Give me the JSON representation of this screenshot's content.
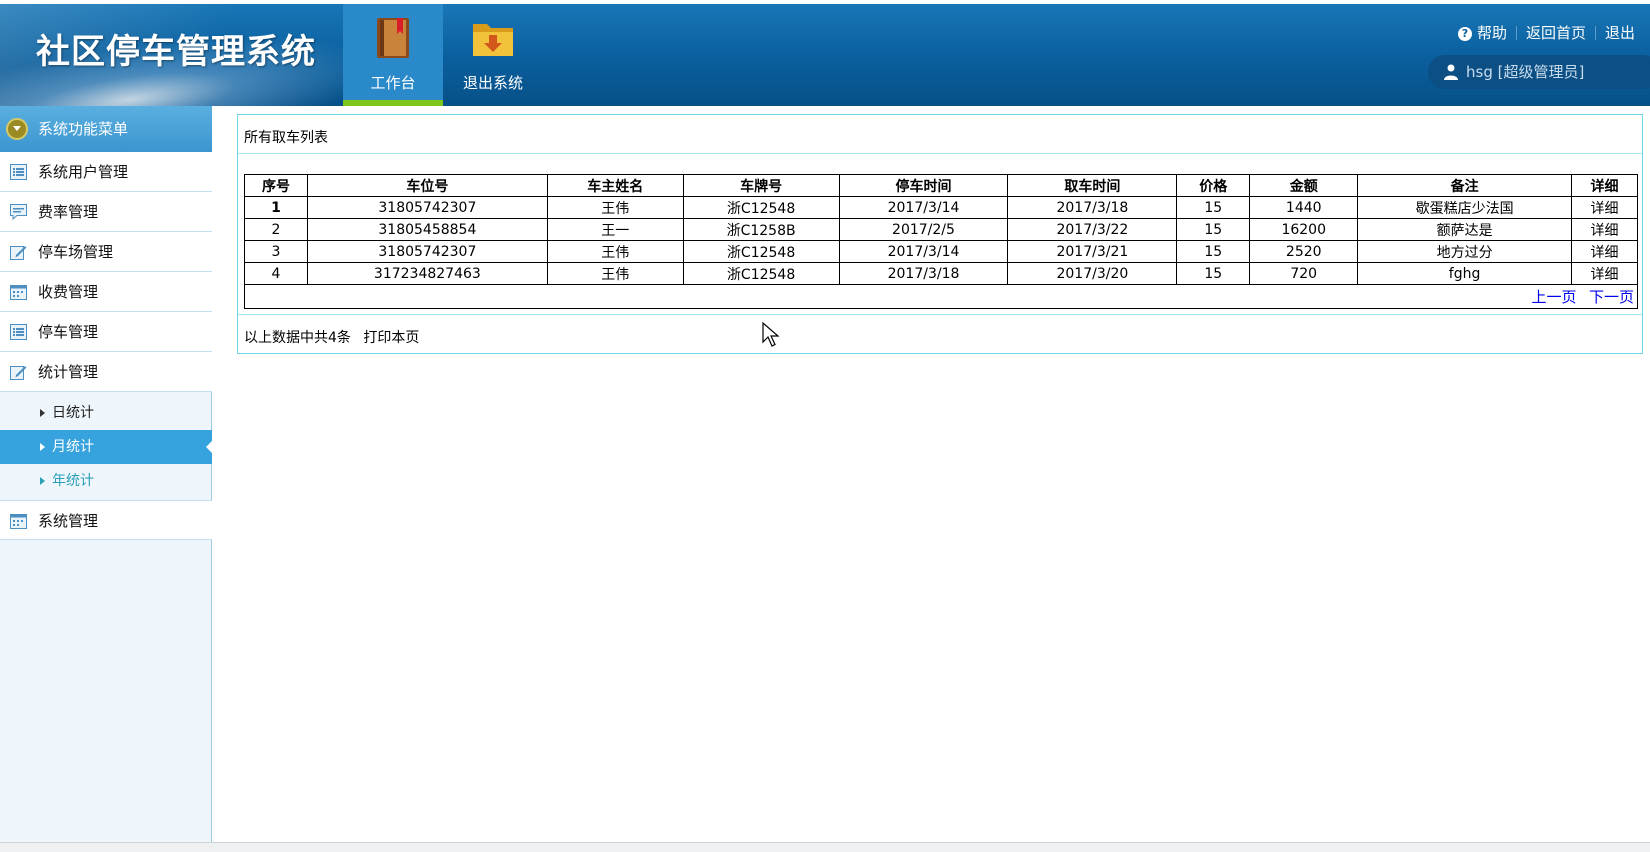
{
  "app": {
    "title": "社区停车管理系统"
  },
  "nav": {
    "workbench": {
      "label": "工作台",
      "icon": "book-icon"
    },
    "logout_system": {
      "label": "退出系统",
      "icon": "folder-download-icon"
    }
  },
  "top_links": {
    "help": "帮助",
    "home": "返回首页",
    "logout": "退出"
  },
  "user": {
    "text": "hsg [超级管理员]"
  },
  "sidebar": {
    "header": "系统功能菜单",
    "items": [
      {
        "label": "系统用户管理",
        "icon": "list-icon"
      },
      {
        "label": "费率管理",
        "icon": "comment-icon"
      },
      {
        "label": "停车场管理",
        "icon": "edit-icon"
      },
      {
        "label": "收费管理",
        "icon": "calendar-icon"
      },
      {
        "label": "停车管理",
        "icon": "list-icon"
      },
      {
        "label": "统计管理",
        "icon": "edit-icon"
      }
    ],
    "sub_items": [
      {
        "label": "日统计"
      },
      {
        "label": "月统计"
      },
      {
        "label": "年统计"
      }
    ],
    "last_item": {
      "label": "系统管理",
      "icon": "calendar-icon"
    }
  },
  "panel": {
    "title": "所有取车列表",
    "columns": [
      "序号",
      "车位号",
      "车主姓名",
      "车牌号",
      "停车时间",
      "取车时间",
      "价格",
      "金额",
      "备注",
      "详细"
    ],
    "rows": [
      [
        "1",
        "31805742307",
        "王伟",
        "浙C12548",
        "2017/3/14",
        "2017/3/18",
        "15",
        "1440",
        "歇蛋糕店少法国",
        "详细"
      ],
      [
        "2",
        "31805458854",
        "王一",
        "浙C1258B",
        "2017/2/5",
        "2017/3/22",
        "15",
        "16200",
        "额萨达是",
        "详细"
      ],
      [
        "3",
        "31805742307",
        "王伟",
        "浙C12548",
        "2017/3/14",
        "2017/3/21",
        "15",
        "2520",
        "地方过分",
        "详细"
      ],
      [
        "4",
        "317234827463",
        "王伟",
        "浙C12548",
        "2017/3/18",
        "2017/3/20",
        "15",
        "720",
        "fghg",
        "详细"
      ]
    ],
    "pager": {
      "prev": "上一页",
      "next": "下一页"
    },
    "footer": {
      "summary": "以上数据中共4条",
      "print": "打印本页"
    }
  },
  "colors": {
    "header_bg": "#0a5f9e",
    "active_tab_underline": "#7ec61c",
    "sidebar_active": "#37a3de",
    "panel_border": "#6fd7e6",
    "link": "#0000ee"
  }
}
